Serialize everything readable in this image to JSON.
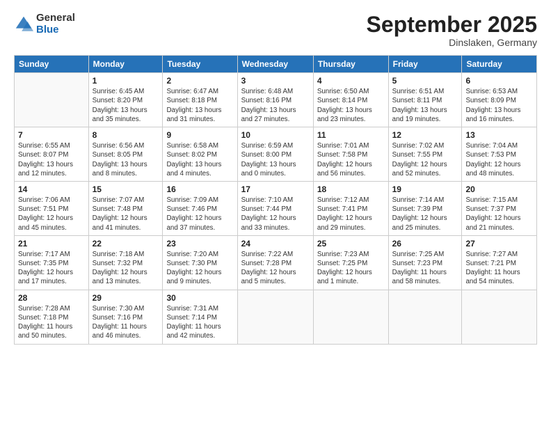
{
  "logo": {
    "general": "General",
    "blue": "Blue"
  },
  "header": {
    "month": "September 2025",
    "location": "Dinslaken, Germany"
  },
  "weekdays": [
    "Sunday",
    "Monday",
    "Tuesday",
    "Wednesday",
    "Thursday",
    "Friday",
    "Saturday"
  ],
  "weeks": [
    [
      {
        "day": "",
        "info": ""
      },
      {
        "day": "1",
        "info": "Sunrise: 6:45 AM\nSunset: 8:20 PM\nDaylight: 13 hours\nand 35 minutes."
      },
      {
        "day": "2",
        "info": "Sunrise: 6:47 AM\nSunset: 8:18 PM\nDaylight: 13 hours\nand 31 minutes."
      },
      {
        "day": "3",
        "info": "Sunrise: 6:48 AM\nSunset: 8:16 PM\nDaylight: 13 hours\nand 27 minutes."
      },
      {
        "day": "4",
        "info": "Sunrise: 6:50 AM\nSunset: 8:14 PM\nDaylight: 13 hours\nand 23 minutes."
      },
      {
        "day": "5",
        "info": "Sunrise: 6:51 AM\nSunset: 8:11 PM\nDaylight: 13 hours\nand 19 minutes."
      },
      {
        "day": "6",
        "info": "Sunrise: 6:53 AM\nSunset: 8:09 PM\nDaylight: 13 hours\nand 16 minutes."
      }
    ],
    [
      {
        "day": "7",
        "info": "Sunrise: 6:55 AM\nSunset: 8:07 PM\nDaylight: 13 hours\nand 12 minutes."
      },
      {
        "day": "8",
        "info": "Sunrise: 6:56 AM\nSunset: 8:05 PM\nDaylight: 13 hours\nand 8 minutes."
      },
      {
        "day": "9",
        "info": "Sunrise: 6:58 AM\nSunset: 8:02 PM\nDaylight: 13 hours\nand 4 minutes."
      },
      {
        "day": "10",
        "info": "Sunrise: 6:59 AM\nSunset: 8:00 PM\nDaylight: 13 hours\nand 0 minutes."
      },
      {
        "day": "11",
        "info": "Sunrise: 7:01 AM\nSunset: 7:58 PM\nDaylight: 12 hours\nand 56 minutes."
      },
      {
        "day": "12",
        "info": "Sunrise: 7:02 AM\nSunset: 7:55 PM\nDaylight: 12 hours\nand 52 minutes."
      },
      {
        "day": "13",
        "info": "Sunrise: 7:04 AM\nSunset: 7:53 PM\nDaylight: 12 hours\nand 48 minutes."
      }
    ],
    [
      {
        "day": "14",
        "info": "Sunrise: 7:06 AM\nSunset: 7:51 PM\nDaylight: 12 hours\nand 45 minutes."
      },
      {
        "day": "15",
        "info": "Sunrise: 7:07 AM\nSunset: 7:48 PM\nDaylight: 12 hours\nand 41 minutes."
      },
      {
        "day": "16",
        "info": "Sunrise: 7:09 AM\nSunset: 7:46 PM\nDaylight: 12 hours\nand 37 minutes."
      },
      {
        "day": "17",
        "info": "Sunrise: 7:10 AM\nSunset: 7:44 PM\nDaylight: 12 hours\nand 33 minutes."
      },
      {
        "day": "18",
        "info": "Sunrise: 7:12 AM\nSunset: 7:41 PM\nDaylight: 12 hours\nand 29 minutes."
      },
      {
        "day": "19",
        "info": "Sunrise: 7:14 AM\nSunset: 7:39 PM\nDaylight: 12 hours\nand 25 minutes."
      },
      {
        "day": "20",
        "info": "Sunrise: 7:15 AM\nSunset: 7:37 PM\nDaylight: 12 hours\nand 21 minutes."
      }
    ],
    [
      {
        "day": "21",
        "info": "Sunrise: 7:17 AM\nSunset: 7:35 PM\nDaylight: 12 hours\nand 17 minutes."
      },
      {
        "day": "22",
        "info": "Sunrise: 7:18 AM\nSunset: 7:32 PM\nDaylight: 12 hours\nand 13 minutes."
      },
      {
        "day": "23",
        "info": "Sunrise: 7:20 AM\nSunset: 7:30 PM\nDaylight: 12 hours\nand 9 minutes."
      },
      {
        "day": "24",
        "info": "Sunrise: 7:22 AM\nSunset: 7:28 PM\nDaylight: 12 hours\nand 5 minutes."
      },
      {
        "day": "25",
        "info": "Sunrise: 7:23 AM\nSunset: 7:25 PM\nDaylight: 12 hours\nand 1 minute."
      },
      {
        "day": "26",
        "info": "Sunrise: 7:25 AM\nSunset: 7:23 PM\nDaylight: 11 hours\nand 58 minutes."
      },
      {
        "day": "27",
        "info": "Sunrise: 7:27 AM\nSunset: 7:21 PM\nDaylight: 11 hours\nand 54 minutes."
      }
    ],
    [
      {
        "day": "28",
        "info": "Sunrise: 7:28 AM\nSunset: 7:18 PM\nDaylight: 11 hours\nand 50 minutes."
      },
      {
        "day": "29",
        "info": "Sunrise: 7:30 AM\nSunset: 7:16 PM\nDaylight: 11 hours\nand 46 minutes."
      },
      {
        "day": "30",
        "info": "Sunrise: 7:31 AM\nSunset: 7:14 PM\nDaylight: 11 hours\nand 42 minutes."
      },
      {
        "day": "",
        "info": ""
      },
      {
        "day": "",
        "info": ""
      },
      {
        "day": "",
        "info": ""
      },
      {
        "day": "",
        "info": ""
      }
    ]
  ]
}
